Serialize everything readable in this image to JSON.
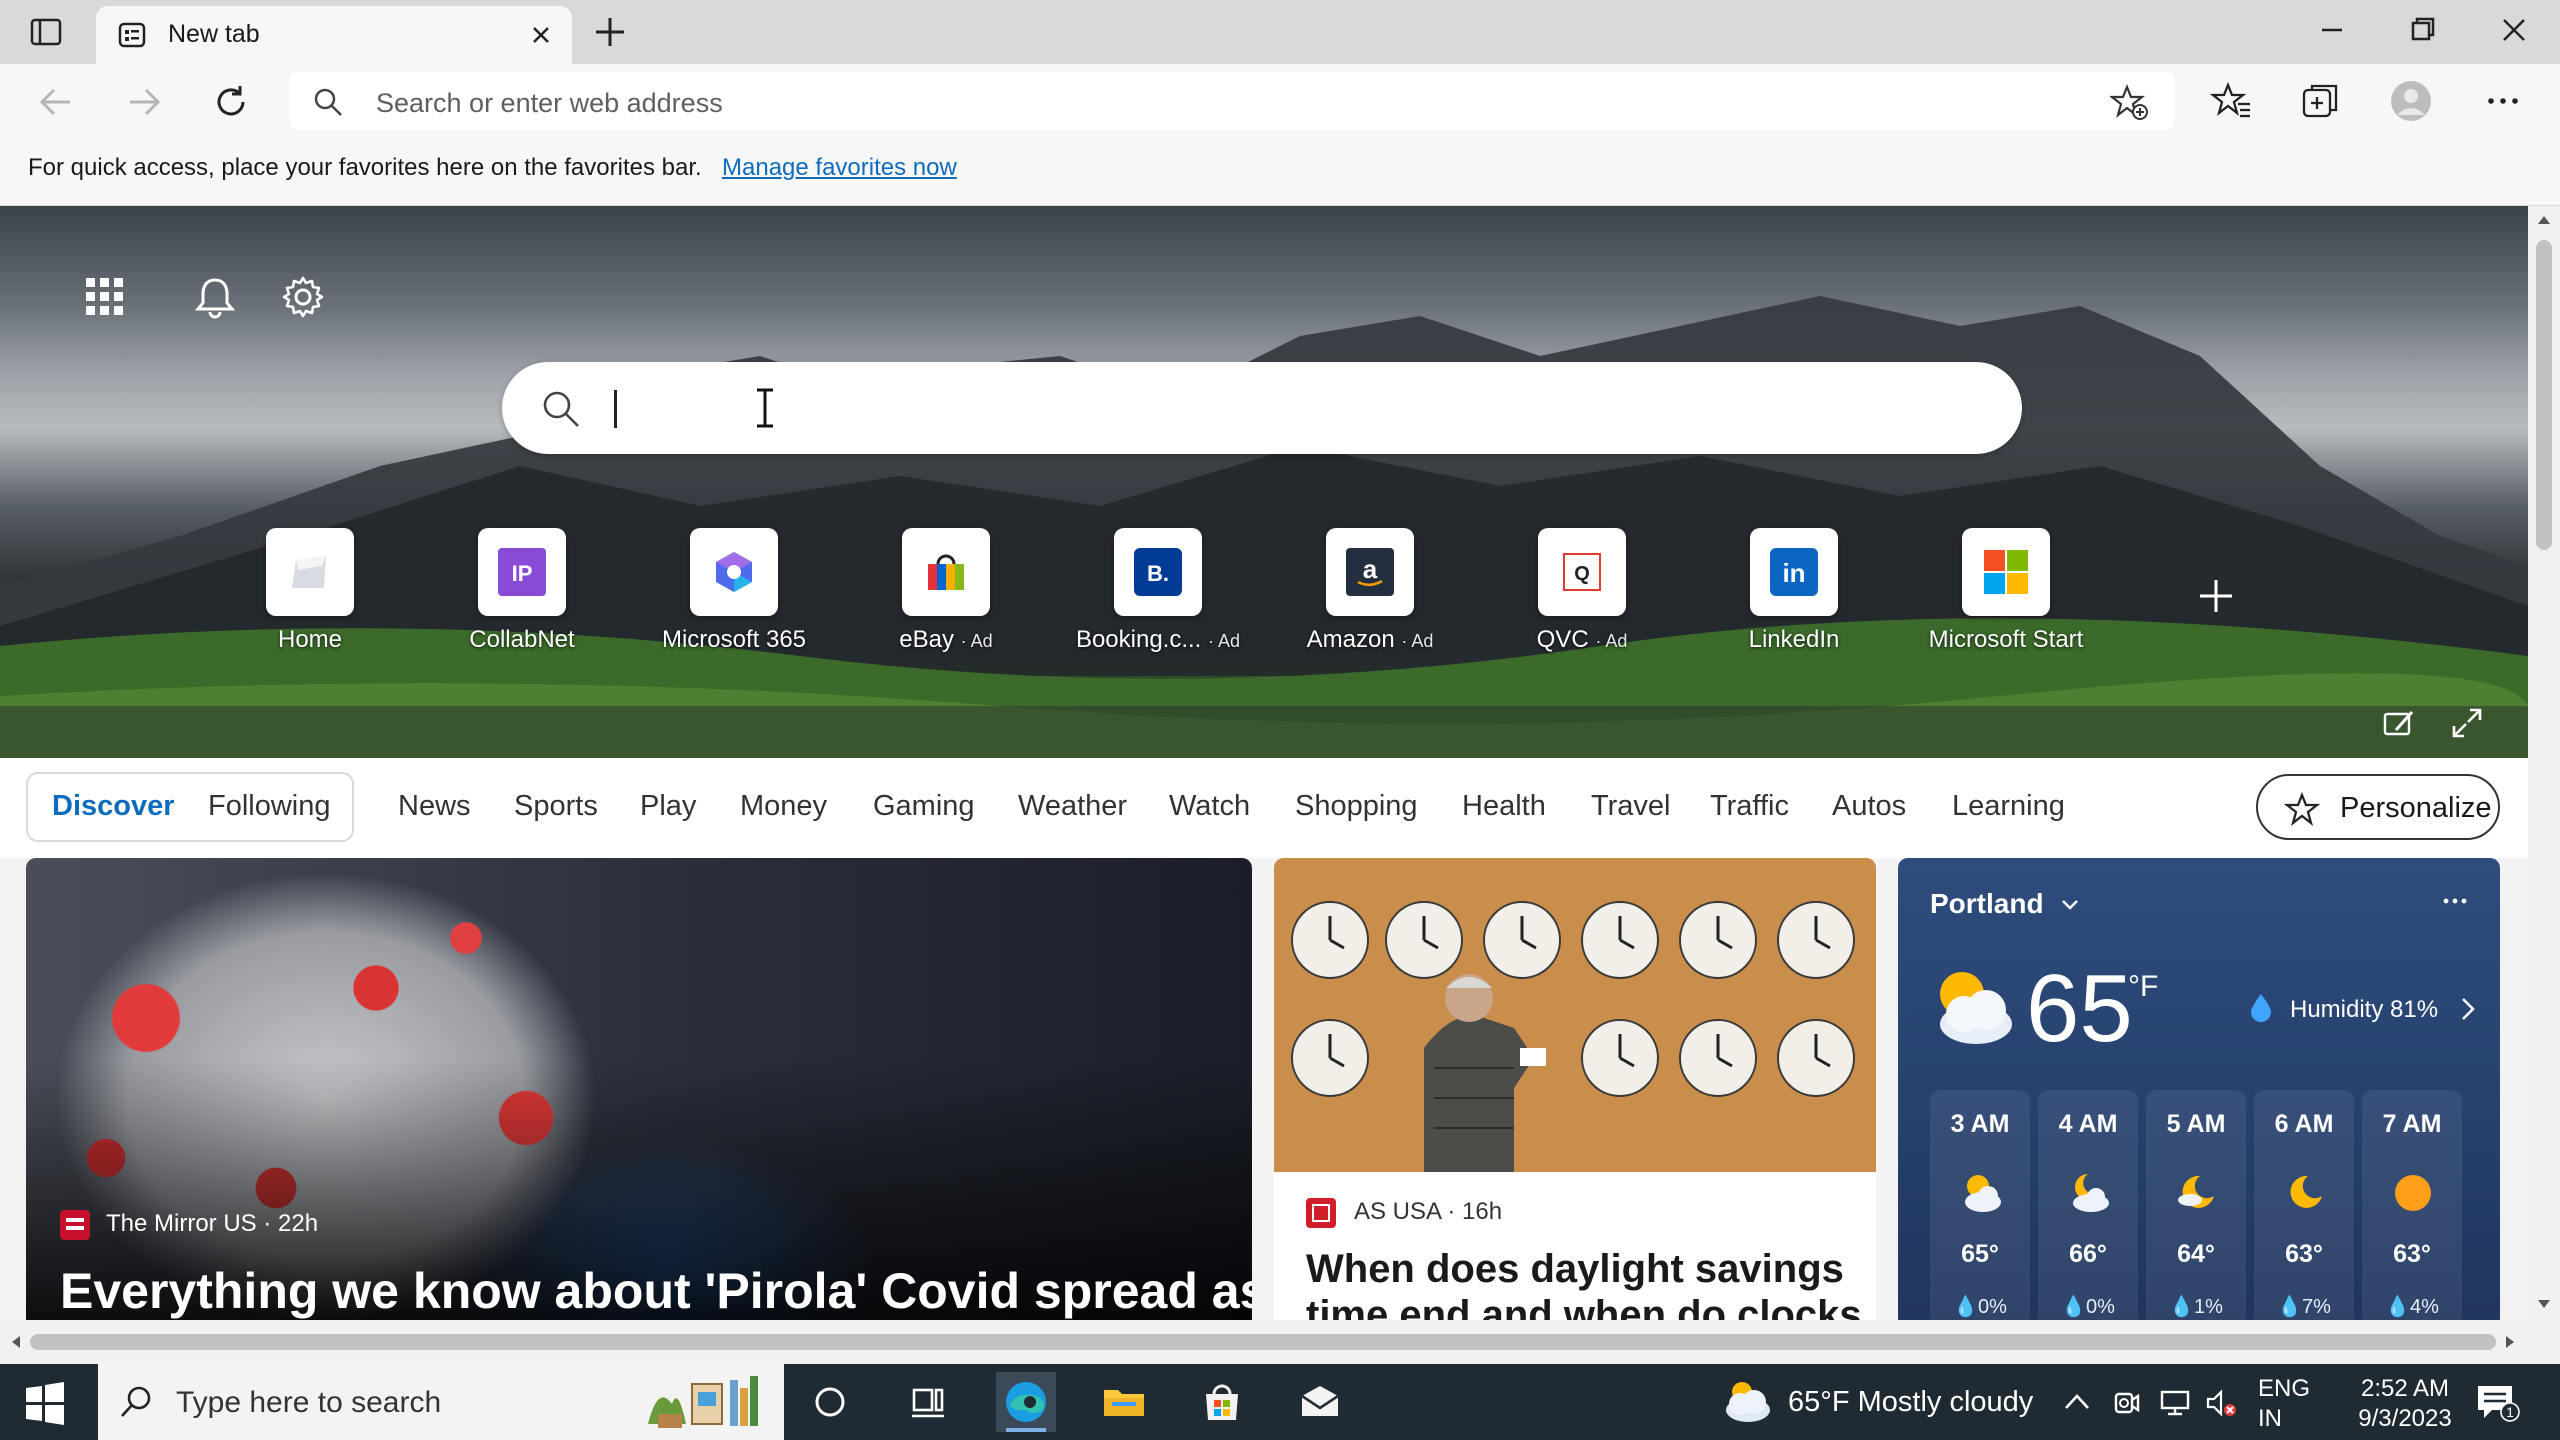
{
  "tab": {
    "title": "New tab"
  },
  "address_bar": {
    "placeholder": "Search or enter web address"
  },
  "favorites_bar": {
    "message": "For quick access, place your favorites here on the favorites bar.",
    "link": "Manage favorites now"
  },
  "quick_links": [
    {
      "label": "Home",
      "ad": "",
      "icon": "home-logo"
    },
    {
      "label": "CollabNet",
      "ad": "",
      "icon": "collabnet-logo",
      "logo_text": "IP"
    },
    {
      "label": "Microsoft 365",
      "ad": "",
      "icon": "microsoft-365-logo"
    },
    {
      "label": "eBay",
      "ad": "· Ad",
      "icon": "ebay-logo"
    },
    {
      "label": "Booking.c...",
      "ad": "· Ad",
      "icon": "booking-logo",
      "logo_text": "B."
    },
    {
      "label": "Amazon",
      "ad": "· Ad",
      "icon": "amazon-logo",
      "logo_text": "a"
    },
    {
      "label": "QVC",
      "ad": "· Ad",
      "icon": "qvc-logo",
      "logo_text": "Q"
    },
    {
      "label": "LinkedIn",
      "ad": "",
      "icon": "linkedin-logo",
      "logo_text": "in"
    },
    {
      "label": "Microsoft Start",
      "ad": "",
      "icon": "microsoft-start-logo"
    }
  ],
  "feed_nav": {
    "discover": "Discover",
    "following": "Following",
    "items": [
      "News",
      "Sports",
      "Play",
      "Money",
      "Gaming",
      "Weather",
      "Watch",
      "Shopping",
      "Health",
      "Travel",
      "Traffic",
      "Autos",
      "Learning"
    ],
    "personalize": "Personalize"
  },
  "cards": {
    "main": {
      "source": "The Mirror US · 22h",
      "headline": "Everything we know about 'Pirola' Covid spread as"
    },
    "second": {
      "source": "AS USA · 16h",
      "headline": "When does daylight savings time end and when do clocks"
    }
  },
  "weather": {
    "location": "Portland",
    "temp": "65",
    "unit": "°F",
    "humidity": "Humidity 81%",
    "hours": [
      {
        "time": "3 AM",
        "temp": "65°",
        "precip": "0%",
        "icon": "partly-cloudy-icon"
      },
      {
        "time": "4 AM",
        "temp": "66°",
        "precip": "0%",
        "icon": "partly-cloudy-night-icon"
      },
      {
        "time": "5 AM",
        "temp": "64°",
        "precip": "1%",
        "icon": "moon-icon"
      },
      {
        "time": "6 AM",
        "temp": "63°",
        "precip": "7%",
        "icon": "moon-icon"
      },
      {
        "time": "7 AM",
        "temp": "63°",
        "precip": "4%",
        "icon": "sun-icon"
      }
    ]
  },
  "taskbar": {
    "search_placeholder": "Type here to search",
    "weather": "65°F  Mostly cloudy",
    "lang_line1": "ENG",
    "lang_line2": "IN",
    "time": "2:52 AM",
    "date": "9/3/2023",
    "notification_count": "1"
  },
  "colors": {
    "accent": "#0f6cbd",
    "taskbar": "#1f2a33",
    "weather_card": "#284370"
  }
}
